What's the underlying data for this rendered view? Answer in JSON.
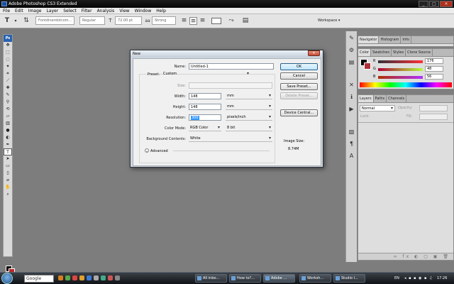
{
  "app": {
    "title": "Adobe Photoshop CS3 Extended"
  },
  "menu": [
    "File",
    "Edit",
    "Image",
    "Layer",
    "Select",
    "Filter",
    "Analysis",
    "View",
    "Window",
    "Help"
  ],
  "options": {
    "font_family": "Fontdinerdotcom...",
    "font_style": "Regular",
    "font_size": "72.00 pt",
    "antialias": "Strong",
    "workspace": "Workspace"
  },
  "toolbox": {
    "logo": "Ps"
  },
  "panels": {
    "nav_tabs": [
      "Navigator",
      "Histogram",
      "Info"
    ],
    "color_tabs": [
      "Color",
      "Swatches",
      "Styles",
      "Clone Source"
    ],
    "color": {
      "r_label": "R",
      "g_label": "G",
      "b_label": "B",
      "r": "176",
      "g": "48",
      "b": "56",
      "fg": "#000000",
      "bg": "#b0303a"
    },
    "layers_tabs": [
      "Layers",
      "Paths",
      "Channels"
    ],
    "blend_mode": "Normal",
    "opacity_label": "Opacity:",
    "lock_label": "Lock:",
    "fill_label": "Fill:"
  },
  "dialog": {
    "title": "New",
    "name_label": "Name:",
    "name_value": "Untitled-1",
    "preset_label": "Preset:",
    "preset_value": "Custom",
    "size_label": "Size:",
    "width_label": "Width:",
    "width_value": "148",
    "width_unit": "mm",
    "height_label": "Height:",
    "height_value": "148",
    "height_unit": "mm",
    "resolution_label": "Resolution:",
    "resolution_value": "300",
    "resolution_unit": "pixels/inch",
    "mode_label": "Color Mode:",
    "mode_value": "RGB Color",
    "depth_value": "8 bit",
    "bg_label": "Background Contents:",
    "bg_value": "White",
    "advanced_label": "Advanced",
    "ok": "OK",
    "cancel": "Cancel",
    "save_preset": "Save Preset...",
    "delete_preset": "Delete Preset...",
    "device_central": "Device Central...",
    "image_size_label": "Image Size:",
    "image_size_value": "8.74M"
  },
  "taskbar": {
    "search": "Google",
    "items": [
      "All inbo...",
      "How to?...",
      "Adobe ...",
      "Worksh...",
      "Studio I..."
    ],
    "lang": "EN",
    "clock": "17:26"
  }
}
